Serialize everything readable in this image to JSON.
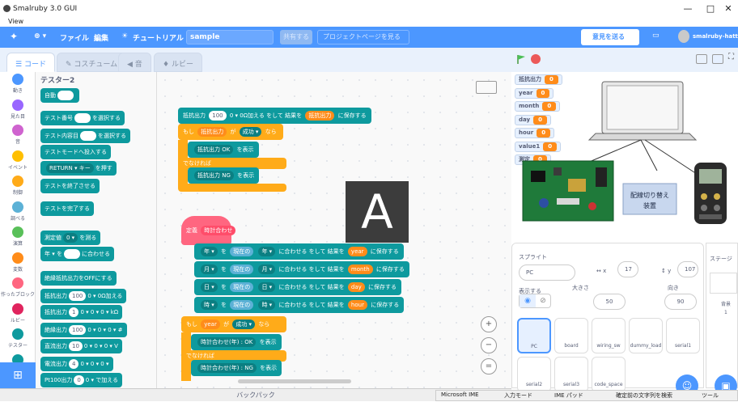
{
  "window": {
    "title": "Smalruby 3.0 GUI",
    "os_menu": "View",
    "minimize": "—",
    "maximize": "□",
    "close": "✕"
  },
  "appbar": {
    "language": "⊕ ▾",
    "file": "ファイル",
    "edit": "編集",
    "tutorial": "チュートリアル",
    "project_name": "sample",
    "share": "共有する",
    "see_project_page": "プロジェクトページを見る",
    "feedback": "意見を送る",
    "username": "smalruby-hatti"
  },
  "tabs": {
    "code": "コード",
    "costumes": "コスチューム",
    "sounds": "音",
    "ruby": "ルビー"
  },
  "categories": [
    {
      "label": "動き",
      "color": "#4c97ff"
    },
    {
      "label": "見た目",
      "color": "#9966ff"
    },
    {
      "label": "音",
      "color": "#cf63cf"
    },
    {
      "label": "イベント",
      "color": "#ffbf00"
    },
    {
      "label": "制御",
      "color": "#ffab19"
    },
    {
      "label": "調べる",
      "color": "#5cb1d6"
    },
    {
      "label": "演算",
      "color": "#59c059"
    },
    {
      "label": "変数",
      "color": "#ff8c1a"
    },
    {
      "label": "作ったブロック",
      "color": "#ff6680"
    },
    {
      "label": "ルビー",
      "color": "#e0245e"
    },
    {
      "label": "テスター",
      "color": "#0e9a9e"
    },
    {
      "label": "テスター2",
      "color": "#0e9a9e"
    }
  ],
  "palette": {
    "heading": "テスター2",
    "blocks": [
      {
        "pre": "自動",
        "mid": "",
        "post": ""
      },
      {
        "pre": "テスト番号",
        "mid": "",
        "post": "を選択する"
      },
      {
        "pre": "テスト内容目",
        "mid": "",
        "post": "を選択する"
      },
      {
        "pre": "テストモードへ投入する",
        "mid": "",
        "post": ""
      },
      {
        "pre": "",
        "mid": "RETURN ▾ キー",
        "post": "を押す"
      },
      {
        "pre": "テストを終了させる",
        "mid": "",
        "post": ""
      },
      {
        "pre": "テストを完了する",
        "mid": "",
        "post": ""
      },
      {
        "pre": "測定値",
        "mid": "0 ▾",
        "post": "を測る"
      },
      {
        "pre": "年 ▾ を",
        "mid": "",
        "post": "に合わせる"
      },
      {
        "pre": "絶縁抵抗出力をOFFにする",
        "mid": "",
        "post": ""
      },
      {
        "pre": "抵抗出力",
        "mid": "100",
        "post": "0 ▾  0Ω加える"
      },
      {
        "pre": "抵抗出力",
        "mid": "1",
        "post": "0 ▾  0 ▾  0 ▾  kΩ"
      },
      {
        "pre": "絶縁出力",
        "mid": "100",
        "post": "0 ▾  0 ▾  0 ▾  #"
      },
      {
        "pre": "直流出力",
        "mid": "10",
        "post": "0 ▾  0 ▾  0 ▾  V"
      },
      {
        "pre": "電流出力",
        "mid": "4",
        "post": "0 ▾  0 ▾  0 ▾"
      },
      {
        "pre": "Pt100出力",
        "mid": "0",
        "post": "0 ▾  で加える"
      }
    ]
  },
  "script": {
    "b1": {
      "a": "抵抗出力",
      "b": "100",
      "c": "0 ▾  0Ω加える  をして 結果を",
      "d": "抵抗出力",
      "e": "に保存する"
    },
    "if1": {
      "a": "もし",
      "b": "抵抗出力",
      "c": "が",
      "d": "成功 ▾",
      "e": "なら"
    },
    "show_ok": {
      "a": "抵抗出力 OK",
      "b": "を表示"
    },
    "else1": "でなければ",
    "show_ng": {
      "a": "抵抗出力 NG",
      "b": "を表示"
    },
    "hat": {
      "a": "定義",
      "b": "時計合わせ"
    },
    "set_year": {
      "a": "年 ▾",
      "b": "を",
      "c": "現在の",
      "d": "年 ▾",
      "e": "に合わせる をして 結果を",
      "f": "year",
      "g": "に保存する"
    },
    "set_month": {
      "a": "月 ▾",
      "b": "を",
      "c": "現在の",
      "d": "月 ▾",
      "e": "に合わせる をして 結果を",
      "f": "month",
      "g": "に保存する"
    },
    "set_day": {
      "a": "日 ▾",
      "b": "を",
      "c": "現在の",
      "d": "日 ▾",
      "e": "に合わせる をして 結果を",
      "f": "day",
      "g": "に保存する"
    },
    "set_hour": {
      "a": "時 ▾",
      "b": "を",
      "c": "現在の",
      "d": "時 ▾",
      "e": "に合わせる をして 結果を",
      "f": "hour",
      "g": "に保存する"
    },
    "if2": {
      "a": "もし",
      "b": "year",
      "c": "が",
      "d": "成功 ▾",
      "e": "なら"
    },
    "show_ok2": {
      "a": "時計合わせ(年) : OK",
      "b": "を表示"
    },
    "else2": "でなければ",
    "show_ng2": {
      "a": "時計合わせ(年) : NG",
      "b": "を表示"
    },
    "overlay_letter": "A",
    "zoom_in": "+",
    "zoom_out": "−",
    "zoom_reset": "="
  },
  "monitors": [
    {
      "name": "抵抗出力",
      "value": "0"
    },
    {
      "name": "year",
      "value": "0"
    },
    {
      "name": "month",
      "value": "0"
    },
    {
      "name": "day",
      "value": "0"
    },
    {
      "name": "hour",
      "value": "0"
    },
    {
      "name": "value1",
      "value": "0"
    },
    {
      "name": "測定",
      "value": "0"
    }
  ],
  "stage_labels": {
    "wiring": "配線切り替え\n装置",
    "wiring_1": "配線切り替え",
    "wiring_2": "装置"
  },
  "sprite_pane": {
    "title": "スプライト",
    "name": "PC",
    "x_label": "x",
    "x": "17",
    "y_label": "y",
    "y": "107",
    "show_label": "表示する",
    "size_label": "大きさ",
    "size": "50",
    "direction_label": "向き",
    "direction": "90",
    "sprites": [
      "PC",
      "board",
      "wiring_sw",
      "dummy_load",
      "serial1",
      "serial2",
      "serial3",
      "code_space"
    ]
  },
  "stage_pane": {
    "title": "ステージ",
    "backdrops_label": "背景",
    "backdrops_count": "1"
  },
  "backpack": "バックパック",
  "ime": {
    "ime": "Microsoft IME",
    "input_mode": "入力モード",
    "ime_pad": "IME パッド",
    "undo": "確定前の文字列を検索",
    "tools": "ツール"
  },
  "colors": {
    "accent": "#4c97ff",
    "tester": "#0e9a9e",
    "control": "#ffab19",
    "myblocks": "#ff6680",
    "variables": "#ff8c1a"
  }
}
